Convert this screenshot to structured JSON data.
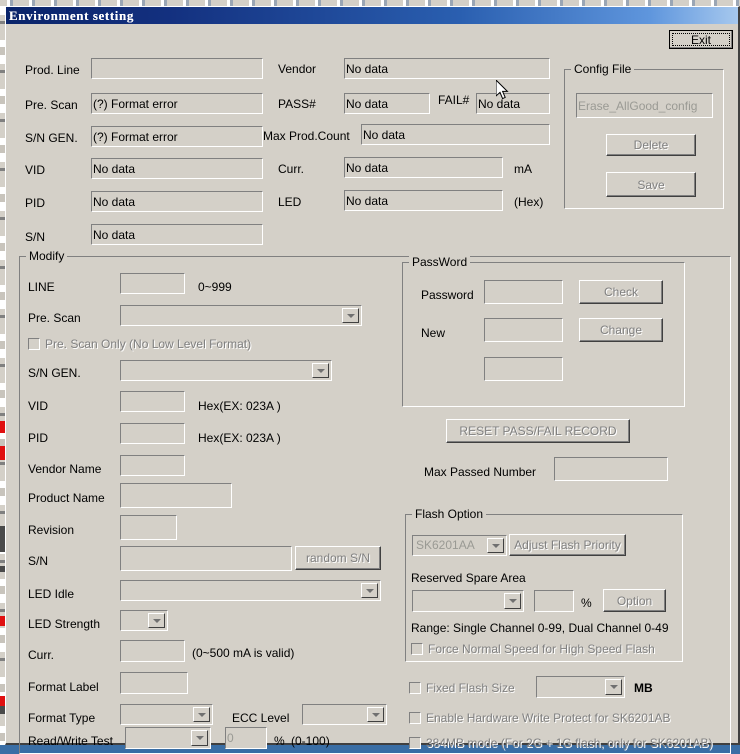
{
  "window": {
    "title": "Environment setting",
    "exit_button": "Exit"
  },
  "info": {
    "prod_line_label": "Prod. Line",
    "prod_line_value": "",
    "pre_scan_label": "Pre. Scan",
    "pre_scan_value": "(?) Format error",
    "sn_gen_label": "S/N GEN.",
    "sn_gen_value": "(?) Format error",
    "vid_label": "VID",
    "vid_value": "No data",
    "pid_label": "PID",
    "pid_value": "No data",
    "sn_label": "S/N",
    "sn_value": "No data",
    "vendor_label": "Vendor",
    "vendor_value": "No data",
    "pass_label": "PASS#",
    "pass_value": "No data",
    "fail_label": "FAIL#",
    "fail_value": "No data",
    "max_prod_count_label": "Max Prod.Count",
    "max_prod_count_value": "No data",
    "curr_label": "Curr.",
    "curr_value": "No data",
    "curr_unit": "mA",
    "led_label": "LED",
    "led_value": "No data",
    "led_unit": "(Hex)"
  },
  "config_file": {
    "group_label": "Config File",
    "file_value": "Erase_AllGood_config",
    "delete_button": "Delete",
    "save_button": "Save"
  },
  "modify": {
    "group_label": "Modify",
    "line_label": "LINE",
    "line_value": "",
    "line_hint": "0~999",
    "pre_scan_label": "Pre. Scan",
    "pre_scan_value": "",
    "pre_scan_only_label": "Pre. Scan Only (No Low Level Format)",
    "sn_gen_label": "S/N GEN.",
    "sn_gen_value": "",
    "vid_label": "VID",
    "vid_value": "",
    "vid_hint": "Hex(EX: 023A )",
    "pid_label": "PID",
    "pid_value": "",
    "pid_hint": "Hex(EX: 023A )",
    "vendor_name_label": "Vendor Name",
    "vendor_name_value": "",
    "product_name_label": "Product Name",
    "product_name_value": "",
    "revision_label": "Revision",
    "revision_value": "",
    "sn_label": "S/N",
    "sn_value": "",
    "random_sn_button": "random S/N",
    "led_idle_label": "LED Idle",
    "led_idle_value": "",
    "led_strength_label": "LED Strength",
    "led_strength_value": "",
    "curr_label": "Curr.",
    "curr_value": "",
    "curr_hint": "(0~500 mA is valid)",
    "format_label_label": "Format Label",
    "format_label_value": "",
    "format_type_label": "Format Type",
    "format_type_value": "",
    "ecc_level_label": "ECC Level",
    "ecc_level_value": "",
    "read_write_test_label": "Read/Write Test",
    "read_write_test_value": "",
    "read_write_percent": "0",
    "percent_sign": "%",
    "read_write_hint": "(0-100)"
  },
  "password": {
    "group_label": "PassWord",
    "password_label": "Password",
    "password_value": "",
    "check_button": "Check",
    "new_label": "New",
    "new_value": "",
    "change_button": "Change",
    "confirm_value": ""
  },
  "records": {
    "reset_button": "RESET PASS/FAIL RECORD",
    "max_passed_label": "Max Passed Number",
    "max_passed_value": ""
  },
  "flash_option": {
    "group_label": "Flash Option",
    "chip_value": "SK6201AA",
    "adjust_priority_button": "Adjust Flash Priority",
    "reserved_spare_label": "Reserved Spare Area",
    "reserved_spare_value": "",
    "reserved_percent_value": "",
    "percent_sign": "%",
    "option_button": "Option",
    "range_note": "Range: Single Channel 0-99, Dual Channel 0-49",
    "force_normal_speed_label": "Force Normal Speed for High Speed Flash"
  },
  "bottom_options": {
    "fixed_flash_size_label": "Fixed Flash Size",
    "fixed_flash_size_value": "",
    "mb_unit": "MB",
    "hw_write_protect_label": "Enable Hardware Write Protect for SK6201AB",
    "mode_384_label": "384MB mode (For 2G + 1G flash, only for SK6201AB)"
  },
  "colors": {
    "face": "#d4d0c8",
    "title_start": "#0a246a",
    "title_end": "#a6c8ee",
    "disabled_text": "#808080"
  }
}
